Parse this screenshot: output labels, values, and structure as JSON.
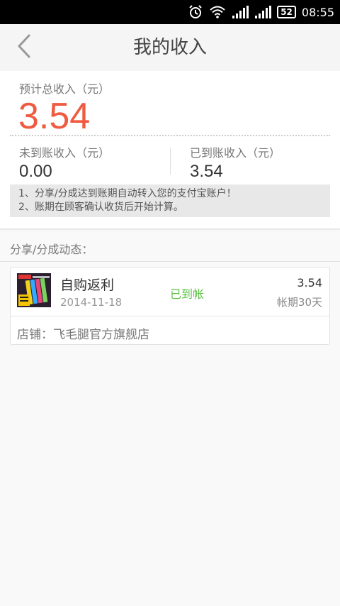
{
  "status_bar": {
    "battery": "52",
    "time": "08:55",
    "icons": [
      "alarm-icon",
      "wifi-icon",
      "signal-icon",
      "signal-icon",
      "battery-icon"
    ]
  },
  "header": {
    "title": "我的收入",
    "back_icon": "chevron-left-icon"
  },
  "summary": {
    "total_label": "预计总收入（元）",
    "total_value": "3.54",
    "pending_label": "未到账收入（元）",
    "pending_value": "0.00",
    "received_label": "已到账收入（元）",
    "received_value": "3.54",
    "notes": [
      "1、分享/分成达到账期自动转入您的支付宝账户！",
      "2、账期在顾客确认收货后开始计算。"
    ]
  },
  "activity": {
    "title": "分享/分成动态：",
    "items": [
      {
        "title": "自购返利",
        "date": "2014-11-18",
        "status": "已到帐",
        "amount": "3.54",
        "period": "帐期30天",
        "store": "店铺：飞毛腿官方旗舰店"
      }
    ]
  },
  "colors": {
    "accent": "#f05a40",
    "status_green": "#5bc245",
    "header_bg": "#f5f5f5"
  }
}
